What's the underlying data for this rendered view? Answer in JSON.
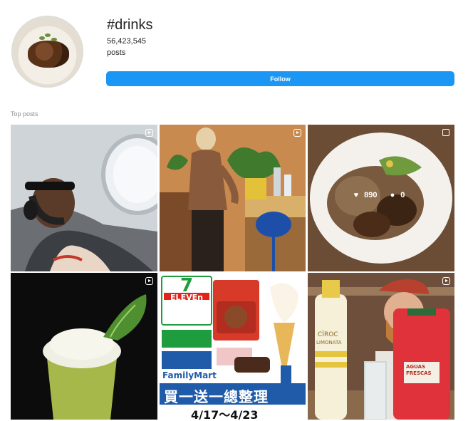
{
  "profile": {
    "hashtag": "#drinks",
    "post_count": "56,423,545",
    "post_unit": "posts",
    "follow_label": "Follow"
  },
  "section": {
    "label": "Top posts"
  },
  "posts": [
    {
      "type": "reel-icon"
    },
    {
      "type": "reel-icon"
    },
    {
      "type": "carousel-icon",
      "likes": "890",
      "comments": "0"
    },
    {
      "type": "reel-icon"
    },
    {
      "type": "none"
    },
    {
      "type": "reel-icon"
    }
  ],
  "promo": {
    "store1": "7-ELEVEN",
    "store2": "FamilyMart",
    "headline": "買一送一總整理",
    "dates": "4/17～4/23"
  },
  "bottle_label": {
    "brand": "CÎROC",
    "flavor": "LIMONATA",
    "can": "AGUAS FRESCAS"
  },
  "colors": {
    "accent": "#1c96f4",
    "promo_blue": "#1f5ba8",
    "seven_green": "#1f9c3e",
    "seven_red": "#e2231a"
  }
}
